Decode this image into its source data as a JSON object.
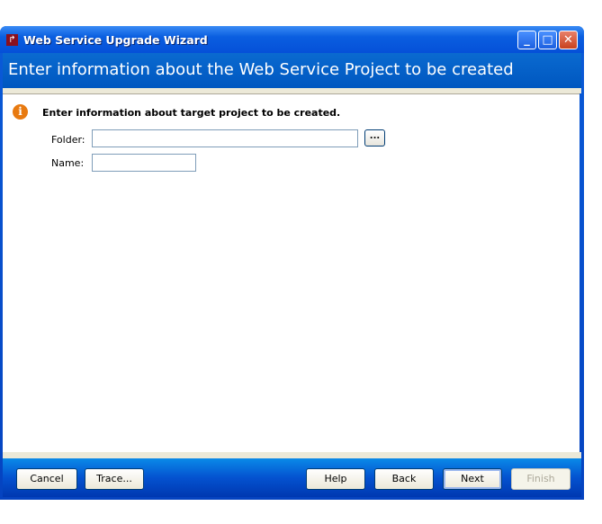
{
  "window": {
    "title": "Web Service Upgrade Wizard",
    "controls": [
      "minimize",
      "maximize",
      "close"
    ]
  },
  "header": {
    "title": "Enter information about the Web Service Project to be created"
  },
  "content": {
    "message": "Enter information about target project to be created.",
    "message_icon": "info-icon",
    "folder": {
      "label": "Folder:",
      "value": "",
      "browse_label": "..."
    },
    "name": {
      "label": "Name:",
      "value": ""
    }
  },
  "footer": {
    "cancel": "Cancel",
    "trace": "Trace...",
    "help": "Help",
    "back": "Back",
    "next": "Next",
    "finish": "Finish",
    "finish_enabled": false
  }
}
